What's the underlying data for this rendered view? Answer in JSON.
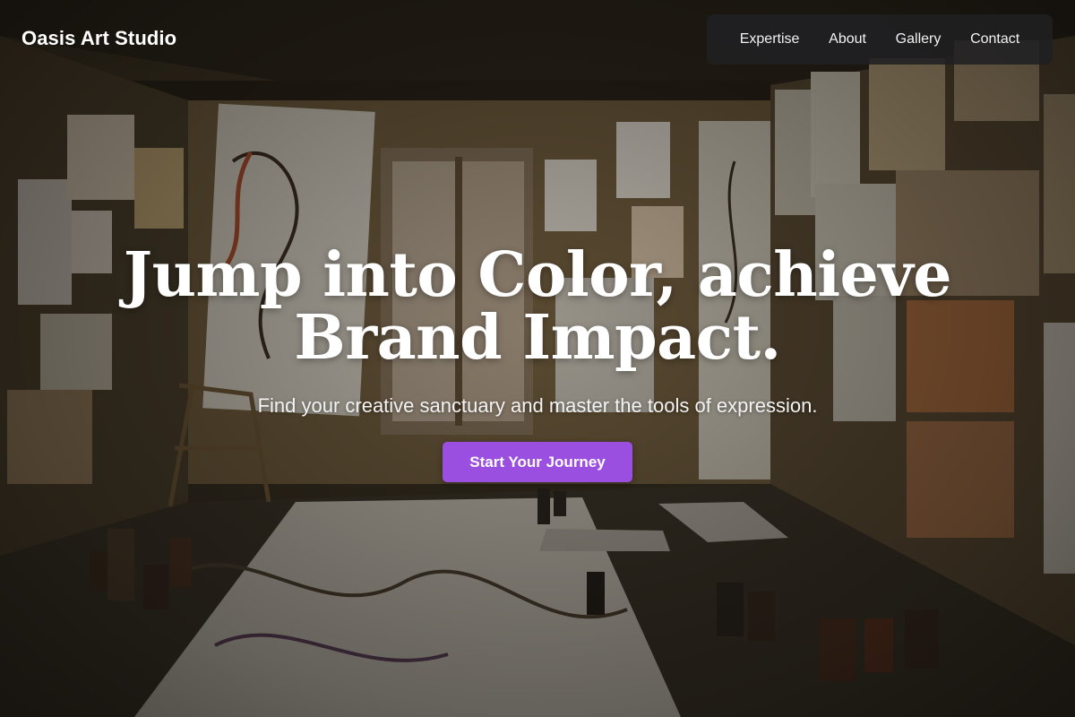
{
  "header": {
    "brand": "Oasis Art Studio"
  },
  "nav": {
    "items": [
      {
        "label": "Expertise"
      },
      {
        "label": "About"
      },
      {
        "label": "Gallery"
      },
      {
        "label": "Contact"
      }
    ]
  },
  "hero": {
    "title_line1": "Jump into Color, achieve",
    "title_line2": "Brand Impact.",
    "subtitle": "Find your creative sanctuary and master the tools of expression.",
    "cta_label": "Start Your Journey",
    "background": "art-studio-photo",
    "colors": {
      "accent": "#9b4fe0",
      "nav_bg": "#202022"
    }
  }
}
